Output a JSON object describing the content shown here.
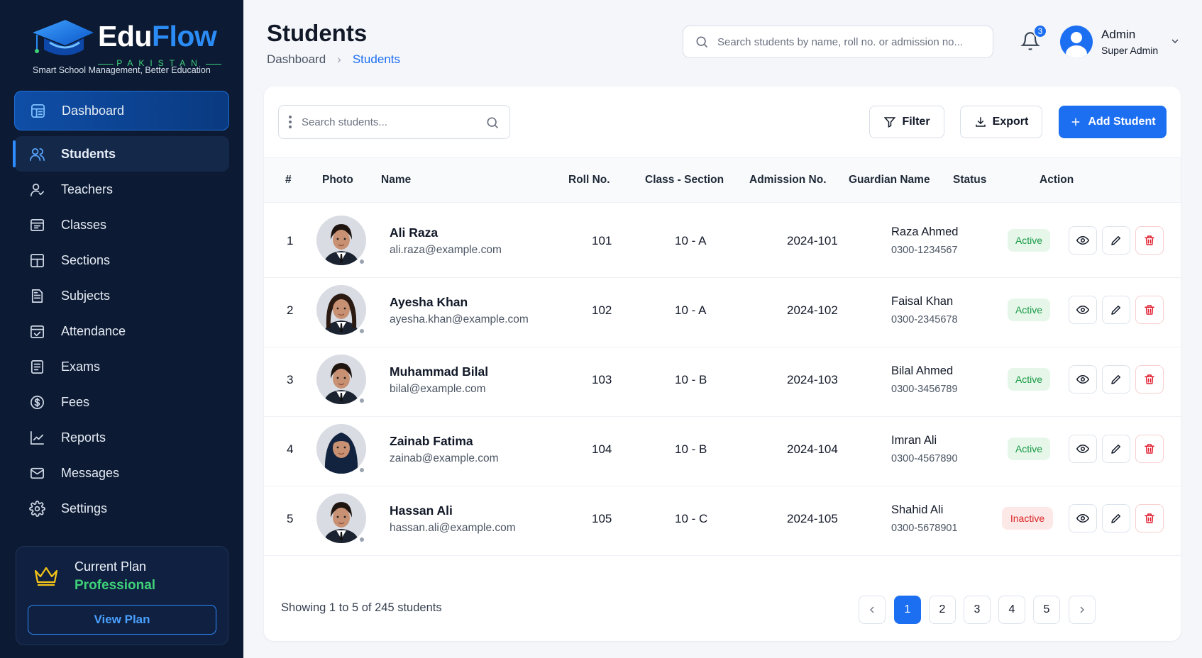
{
  "brand": {
    "name_part1": "Edu",
    "name_part2": "Flow",
    "country": "PAKISTAN",
    "tagline": "Smart School Management, Better Education"
  },
  "sidebar": {
    "items": [
      {
        "label": "Dashboard",
        "icon": "dashboard-icon"
      },
      {
        "label": "Students",
        "icon": "students-icon"
      },
      {
        "label": "Teachers",
        "icon": "teachers-icon"
      },
      {
        "label": "Classes",
        "icon": "classes-icon"
      },
      {
        "label": "Sections",
        "icon": "sections-icon"
      },
      {
        "label": "Subjects",
        "icon": "subjects-icon"
      },
      {
        "label": "Attendance",
        "icon": "attendance-icon"
      },
      {
        "label": "Exams",
        "icon": "exams-icon"
      },
      {
        "label": "Fees",
        "icon": "fees-icon"
      },
      {
        "label": "Reports",
        "icon": "reports-icon"
      },
      {
        "label": "Messages",
        "icon": "messages-icon"
      },
      {
        "label": "Settings",
        "icon": "settings-icon"
      }
    ]
  },
  "plan": {
    "label": "Current Plan",
    "tier": "Professional",
    "button": "View Plan"
  },
  "header": {
    "title": "Students",
    "breadcrumb": [
      "Dashboard",
      "Students"
    ],
    "search_placeholder": "Search students by name, roll no. or admission no...",
    "notifications": "3",
    "user_name": "Admin",
    "user_role": "Super Admin"
  },
  "toolbar": {
    "search_placeholder": "Search students...",
    "filter": "Filter",
    "export": "Export",
    "add": "Add Student"
  },
  "table": {
    "columns": [
      "#",
      "Photo",
      "Name",
      "Roll No.",
      "Class - Section",
      "Admission No.",
      "Guardian Name",
      "Status",
      "Action"
    ],
    "rows": [
      {
        "num": "1",
        "name": "Ali Raza",
        "email": "ali.raza@example.com",
        "roll": "101",
        "class": "10 - A",
        "admission": "2024-101",
        "guardian": "Raza Ahmed",
        "phone": "0300-1234567",
        "status": "Active"
      },
      {
        "num": "2",
        "name": "Ayesha Khan",
        "email": "ayesha.khan@example.com",
        "roll": "102",
        "class": "10 - A",
        "admission": "2024-102",
        "guardian": "Faisal Khan",
        "phone": "0300-2345678",
        "status": "Active"
      },
      {
        "num": "3",
        "name": "Muhammad Bilal",
        "email": "bilal@example.com",
        "roll": "103",
        "class": "10 - B",
        "admission": "2024-103",
        "guardian": "Bilal Ahmed",
        "phone": "0300-3456789",
        "status": "Active"
      },
      {
        "num": "4",
        "name": "Zainab Fatima",
        "email": "zainab@example.com",
        "roll": "104",
        "class": "10 - B",
        "admission": "2024-104",
        "guardian": "Imran Ali",
        "phone": "0300-4567890",
        "status": "Active"
      },
      {
        "num": "5",
        "name": "Hassan Ali",
        "email": "hassan.ali@example.com",
        "roll": "105",
        "class": "10 - C",
        "admission": "2024-105",
        "guardian": "Shahid Ali",
        "phone": "0300-5678901",
        "status": "Inactive"
      }
    ]
  },
  "footer": {
    "showing": "Showing 1 to 5 of 245 students",
    "pages": [
      "1",
      "2",
      "3",
      "4",
      "5"
    ],
    "current_page": "1"
  },
  "colors": {
    "sidebar_bg": "#0c1a33",
    "accent": "#1d6ff2",
    "active_green": "#1a9a46",
    "inactive_red": "#dc2626",
    "plan_green": "#3fd17a"
  }
}
